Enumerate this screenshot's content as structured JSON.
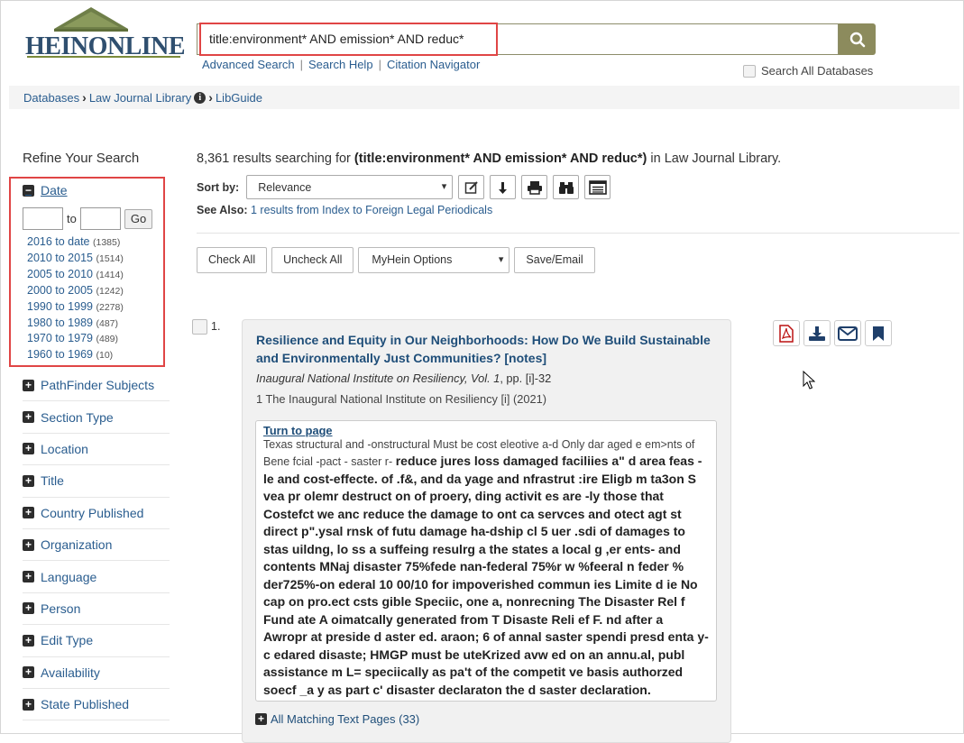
{
  "logo": {
    "text": "HEINONLINE"
  },
  "search": {
    "query": "title:environment* AND emission* AND reduc*"
  },
  "search_links": [
    "Advanced Search",
    "Search Help",
    "Citation Navigator"
  ],
  "search_all_label": "Search All Databases",
  "breadcrumb": {
    "databases": "Databases",
    "library": "Law Journal Library",
    "info": "i",
    "libguide": "LibGuide"
  },
  "sidebar": {
    "title": "Refine Your Search",
    "date": {
      "label": "Date",
      "to": "to",
      "go": "Go",
      "ranges": [
        {
          "label": "2016 to date",
          "count": "(1385)"
        },
        {
          "label": "2010 to 2015",
          "count": "(1514)"
        },
        {
          "label": "2005 to 2010",
          "count": "(1414)"
        },
        {
          "label": "2000 to 2005",
          "count": "(1242)"
        },
        {
          "label": "1990 to 1999",
          "count": "(2278)"
        },
        {
          "label": "1980 to 1989",
          "count": "(487)"
        },
        {
          "label": "1970 to 1979",
          "count": "(489)"
        },
        {
          "label": "1960 to 1969",
          "count": "(10)"
        }
      ]
    },
    "facets": [
      "PathFinder Subjects",
      "Section Type",
      "Location",
      "Title",
      "Country Published",
      "Organization",
      "Language",
      "Person",
      "Edit Type",
      "Availability",
      "State Published"
    ]
  },
  "results": {
    "count": "8,361",
    "summary_pre": "results searching for",
    "summary_query": "(title:environment* AND emission* AND reduc*)",
    "summary_post": "in Law Journal Library.",
    "sort_label": "Sort by:",
    "sort_value": "Relevance",
    "see_also_label": "See Also:",
    "see_also_link": "1 results from Index to Foreign Legal Periodicals",
    "check_all": "Check All",
    "uncheck_all": "Uncheck All",
    "myhein": "MyHein Options",
    "save_email": "Save/Email"
  },
  "result1": {
    "number": "1.",
    "title": "Resilience and Equity in Our Neighborhoods: How Do We Build Sustainable and Environmentally Just Communities? [notes]",
    "journal": "Inaugural National Institute on Resiliency, Vol. 1",
    "pages": ", pp. [i]-32",
    "volume_line": "1 The Inaugural National Institute on Resiliency [i] (2021)",
    "turn_to_page": "Turn to page",
    "snippet_plain": "Texas structural and -onstructural Must be cost eleotive a-d Only dar aged e em>nts of Bene fcial -pact - saster r-",
    "snippet_bold": "reduce jures loss damaged faciliies a\" d area feas -le and cost-effecte. of .f&, and da yage and nfrastrut :ire Eligb m ta3on S vea pr olemr destruct on of proery, ding activit es are -ly those that Costefct we anc reduce the damage to ont ca servces and otect agt st direct p\".ysal rnsk of futu damage ha-dship cl 5 uer .sdi of damages to stas uildng, lo ss a suffeing resulrg a the states a local g ,er ents- and contents MNaj disaster 75%fede nan-federal 75%r w %feeral n feder % der725%-on ederal 10 00/10 for impoverished commun ies Limite d ie No cap on pro.ect csts gible Speciic, one a, nonrecning The Disaster Rel f Fund ate A oimatcally generated from T Disaste Reli ef F. nd after a Awropr at preside d aster ed. araon; 6 of annal saster spendi presd enta y-c edared disaste; HMGP must be uteKrized avw ed on an annu.al, publ assistance m L= speciically as pa't of the competit ve basis authorzed soecf _a y as part c' disaster declaraton the d saster declaration.",
    "all_matching": "All Matching Text Pages (33)"
  }
}
